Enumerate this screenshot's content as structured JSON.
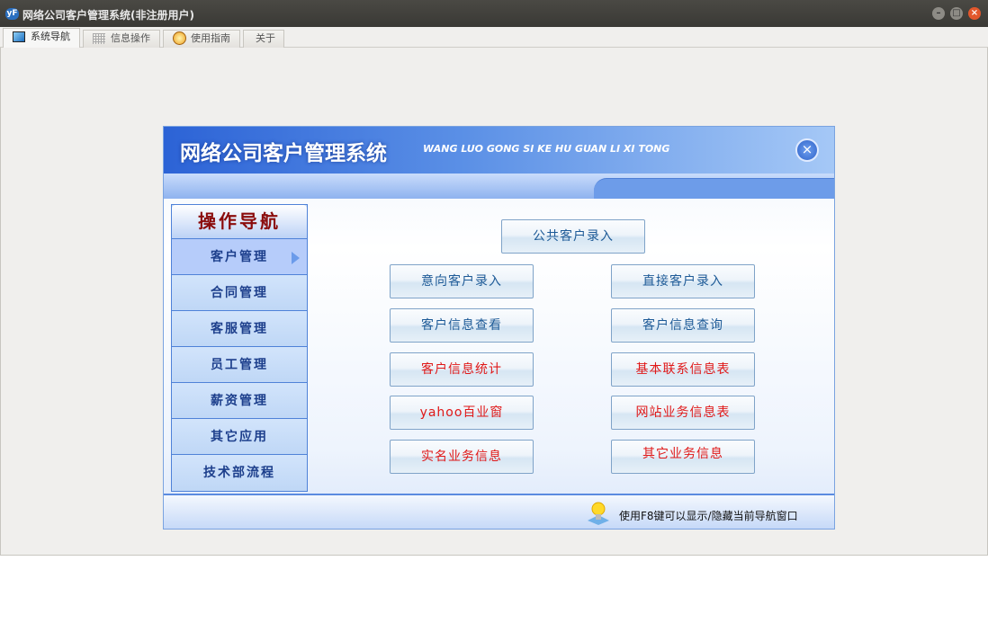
{
  "window": {
    "title": "网络公司客户管理系统(非注册用户)",
    "logo": "yF"
  },
  "tabs": [
    {
      "label": "系统导航"
    },
    {
      "label": "信息操作"
    },
    {
      "label": "使用指南"
    },
    {
      "label": "关于"
    }
  ],
  "panel": {
    "title": "网络公司客户管理系统",
    "subtitle": "WANG LUO GONG SI KE HU GUAN LI XI TONG",
    "close": "×"
  },
  "sidebar": {
    "title": "操作导航",
    "items": [
      {
        "label": "客户管理"
      },
      {
        "label": "合同管理"
      },
      {
        "label": "客服管理"
      },
      {
        "label": "员工管理"
      },
      {
        "label": "薪资管理"
      },
      {
        "label": "其它应用"
      },
      {
        "label": "技术部流程"
      }
    ]
  },
  "buttons": {
    "public": "公共客户录入",
    "intent": "意向客户录入",
    "direct": "直接客户录入",
    "view": "客户信息查看",
    "query": "客户信息查询",
    "stats": "客户信息统计",
    "contacts": "基本联系信息表",
    "yahoo": "yahoo百业窗",
    "website": "网站业务信息表",
    "realname": "实名业务信息",
    "other": "其它业务信息"
  },
  "footer": {
    "tip": "使用F8键可以显示/隐藏当前导航窗口"
  },
  "colors": {
    "accent": "#2c63d6",
    "red_text": "#e01818",
    "blue_text": "#1d5a97"
  }
}
